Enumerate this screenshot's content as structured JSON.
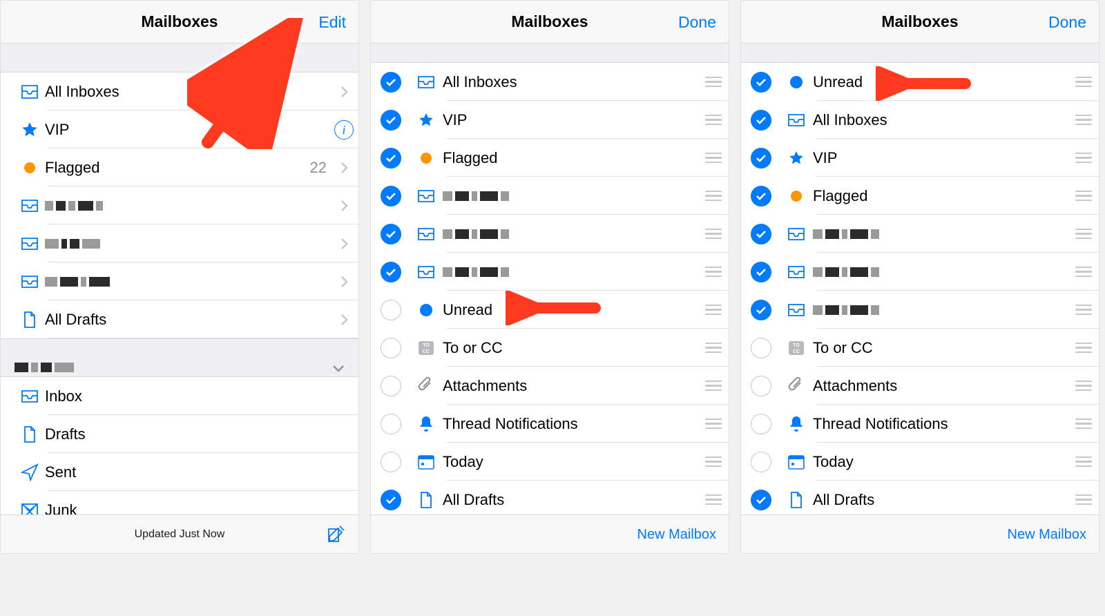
{
  "panels": [
    {
      "title": "Mailboxes",
      "right_button": "Edit",
      "bottom_status": "Updated Just Now",
      "bottom_right": "compose",
      "rows": [
        {
          "label": "All Inboxes",
          "icon": "inbox",
          "accessory": "chevron"
        },
        {
          "label": "VIP",
          "icon": "star",
          "accessory": "info"
        },
        {
          "label": "Flagged",
          "icon": "dot-orange",
          "count": "22",
          "accessory": "chevron"
        },
        {
          "label": "",
          "icon": "inbox",
          "accessory": "chevron",
          "censored": true
        },
        {
          "label": "",
          "icon": "inbox",
          "accessory": "chevron",
          "censored": true
        },
        {
          "label": "",
          "icon": "inbox",
          "accessory": "chevron",
          "censored": true
        },
        {
          "label": "All Drafts",
          "icon": "page",
          "accessory": "chevron"
        }
      ],
      "account_rows": [
        {
          "label": "Inbox",
          "icon": "inbox"
        },
        {
          "label": "Drafts",
          "icon": "page"
        },
        {
          "label": "Sent",
          "icon": "send"
        },
        {
          "label": "Junk",
          "icon": "junk"
        }
      ]
    },
    {
      "title": "Mailboxes",
      "right_button": "Done",
      "bottom_right_text": "New Mailbox",
      "rows": [
        {
          "label": "All Inboxes",
          "icon": "inbox",
          "checked": true
        },
        {
          "label": "VIP",
          "icon": "star",
          "checked": true
        },
        {
          "label": "Flagged",
          "icon": "dot-orange",
          "checked": true
        },
        {
          "label": "",
          "icon": "inbox",
          "checked": true,
          "censored": true
        },
        {
          "label": "",
          "icon": "inbox",
          "checked": true,
          "censored": true
        },
        {
          "label": "",
          "icon": "inbox",
          "checked": true,
          "censored": true
        },
        {
          "label": "Unread",
          "icon": "dot-blue",
          "checked": false
        },
        {
          "label": "To or CC",
          "icon": "tocc",
          "checked": false
        },
        {
          "label": "Attachments",
          "icon": "clip",
          "checked": false
        },
        {
          "label": "Thread Notifications",
          "icon": "bell",
          "checked": false
        },
        {
          "label": "Today",
          "icon": "calendar",
          "checked": false
        },
        {
          "label": "All Drafts",
          "icon": "page",
          "checked": true
        }
      ]
    },
    {
      "title": "Mailboxes",
      "right_button": "Done",
      "bottom_right_text": "New Mailbox",
      "rows": [
        {
          "label": "Unread",
          "icon": "dot-blue",
          "checked": true
        },
        {
          "label": "All Inboxes",
          "icon": "inbox",
          "checked": true
        },
        {
          "label": "VIP",
          "icon": "star",
          "checked": true
        },
        {
          "label": "Flagged",
          "icon": "dot-orange",
          "checked": true
        },
        {
          "label": "",
          "icon": "inbox",
          "checked": true,
          "censored": true
        },
        {
          "label": "",
          "icon": "inbox",
          "checked": true,
          "censored": true
        },
        {
          "label": "",
          "icon": "inbox",
          "checked": true,
          "censored": true
        },
        {
          "label": "To or CC",
          "icon": "tocc",
          "checked": false
        },
        {
          "label": "Attachments",
          "icon": "clip",
          "checked": false
        },
        {
          "label": "Thread Notifications",
          "icon": "bell",
          "checked": false
        },
        {
          "label": "Today",
          "icon": "calendar",
          "checked": false
        },
        {
          "label": "All Drafts",
          "icon": "page",
          "checked": true
        }
      ]
    }
  ]
}
